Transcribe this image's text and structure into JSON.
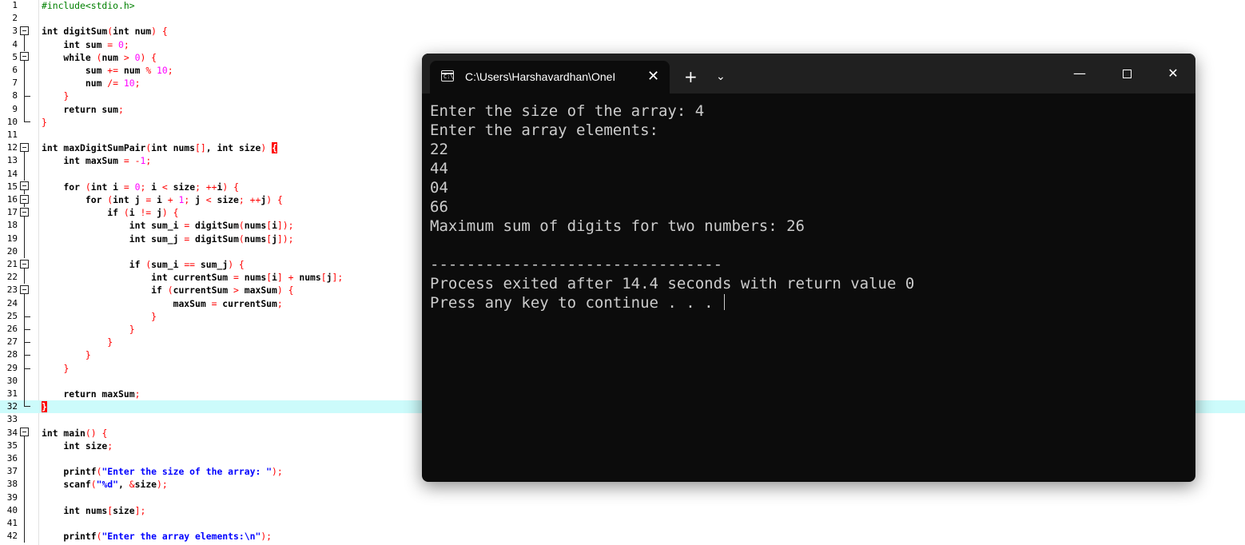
{
  "editor": {
    "lines": [
      {
        "n": "1",
        "fold": "",
        "html": "<span class=\"pp\">#include&lt;stdio.h&gt;</span>"
      },
      {
        "n": "2",
        "fold": "",
        "html": ""
      },
      {
        "n": "3",
        "fold": "open",
        "html": "int digitSum<span class=\"op\">(</span>int num<span class=\"op\">)</span> <span class=\"op\">{</span>"
      },
      {
        "n": "4",
        "fold": "line",
        "html": "    int sum <span class=\"op\">=</span> <span class=\"num\">0</span><span class=\"op\">;</span>"
      },
      {
        "n": "5",
        "fold": "open",
        "html": "    while <span class=\"op\">(</span>num <span class=\"op\">&gt;</span> <span class=\"num\">0</span><span class=\"op\">)</span> <span class=\"op\">{</span>"
      },
      {
        "n": "6",
        "fold": "line",
        "html": "        sum <span class=\"op\">+=</span> num <span class=\"op\">%</span> <span class=\"num\">10</span><span class=\"op\">;</span>"
      },
      {
        "n": "7",
        "fold": "line",
        "html": "        num <span class=\"op\">/=</span> <span class=\"num\">10</span><span class=\"op\">;</span>"
      },
      {
        "n": "8",
        "fold": "mid",
        "html": "    <span class=\"op\">}</span>"
      },
      {
        "n": "9",
        "fold": "line",
        "html": "    return sum<span class=\"op\">;</span>"
      },
      {
        "n": "10",
        "fold": "end",
        "html": "<span class=\"op\">}</span>"
      },
      {
        "n": "11",
        "fold": "",
        "html": ""
      },
      {
        "n": "12",
        "fold": "open",
        "html": "int maxDigitSumPair<span class=\"op\">(</span>int nums<span class=\"op\">[]</span>, int size<span class=\"op\">)</span> <span class=\"brk\">{</span>"
      },
      {
        "n": "13",
        "fold": "line",
        "html": "    int maxSum <span class=\"op\">=</span> <span class=\"op\">-</span><span class=\"num\">1</span><span class=\"op\">;</span>"
      },
      {
        "n": "14",
        "fold": "line",
        "html": ""
      },
      {
        "n": "15",
        "fold": "open",
        "html": "    for <span class=\"op\">(</span>int i <span class=\"op\">=</span> <span class=\"num\">0</span><span class=\"op\">;</span> i <span class=\"op\">&lt;</span> size<span class=\"op\">;</span> <span class=\"op\">++</span>i<span class=\"op\">)</span> <span class=\"op\">{</span>"
      },
      {
        "n": "16",
        "fold": "open",
        "html": "        for <span class=\"op\">(</span>int j <span class=\"op\">=</span> i <span class=\"op\">+</span> <span class=\"num\">1</span><span class=\"op\">;</span> j <span class=\"op\">&lt;</span> size<span class=\"op\">;</span> <span class=\"op\">++</span>j<span class=\"op\">)</span> <span class=\"op\">{</span>"
      },
      {
        "n": "17",
        "fold": "open",
        "html": "            if <span class=\"op\">(</span>i <span class=\"op\">!=</span> j<span class=\"op\">)</span> <span class=\"op\">{</span>"
      },
      {
        "n": "18",
        "fold": "line",
        "html": "                int sum_i <span class=\"op\">=</span> digitSum<span class=\"op\">(</span>nums<span class=\"op\">[</span>i<span class=\"op\">]);</span>"
      },
      {
        "n": "19",
        "fold": "line",
        "html": "                int sum_j <span class=\"op\">=</span> digitSum<span class=\"op\">(</span>nums<span class=\"op\">[</span>j<span class=\"op\">]);</span>"
      },
      {
        "n": "20",
        "fold": "line",
        "html": ""
      },
      {
        "n": "21",
        "fold": "open",
        "html": "                if <span class=\"op\">(</span>sum_i <span class=\"op\">==</span> sum_j<span class=\"op\">)</span> <span class=\"op\">{</span>"
      },
      {
        "n": "22",
        "fold": "line",
        "html": "                    int currentSum <span class=\"op\">=</span> nums<span class=\"op\">[</span>i<span class=\"op\">]</span> <span class=\"op\">+</span> nums<span class=\"op\">[</span>j<span class=\"op\">];</span>"
      },
      {
        "n": "23",
        "fold": "open",
        "html": "                    if <span class=\"op\">(</span>currentSum <span class=\"op\">&gt;</span> maxSum<span class=\"op\">)</span> <span class=\"op\">{</span>"
      },
      {
        "n": "24",
        "fold": "line",
        "html": "                        maxSum <span class=\"op\">=</span> currentSum<span class=\"op\">;</span>"
      },
      {
        "n": "25",
        "fold": "mid",
        "html": "                    <span class=\"op\">}</span>"
      },
      {
        "n": "26",
        "fold": "mid",
        "html": "                <span class=\"op\">}</span>"
      },
      {
        "n": "27",
        "fold": "mid",
        "html": "            <span class=\"op\">}</span>"
      },
      {
        "n": "28",
        "fold": "mid",
        "html": "        <span class=\"op\">}</span>"
      },
      {
        "n": "29",
        "fold": "mid",
        "html": "    <span class=\"op\">}</span>"
      },
      {
        "n": "30",
        "fold": "line",
        "html": ""
      },
      {
        "n": "31",
        "fold": "line",
        "html": "    return maxSum<span class=\"op\">;</span>"
      },
      {
        "n": "32",
        "fold": "end",
        "html": "<span class=\"brk\">}</span>",
        "highlight": true
      },
      {
        "n": "33",
        "fold": "",
        "html": ""
      },
      {
        "n": "34",
        "fold": "open",
        "html": "int main<span class=\"op\">()</span> <span class=\"op\">{</span>"
      },
      {
        "n": "35",
        "fold": "line",
        "html": "    int size<span class=\"op\">;</span>"
      },
      {
        "n": "36",
        "fold": "line",
        "html": ""
      },
      {
        "n": "37",
        "fold": "line",
        "html": "    printf<span class=\"op\">(</span><span class=\"str\">\"Enter the size of the array: \"</span><span class=\"op\">);</span>"
      },
      {
        "n": "38",
        "fold": "line",
        "html": "    scanf<span class=\"op\">(</span><span class=\"str\">\"%d\"</span>, <span class=\"op\">&amp;</span>size<span class=\"op\">);</span>"
      },
      {
        "n": "39",
        "fold": "line",
        "html": ""
      },
      {
        "n": "40",
        "fold": "line",
        "html": "    int nums<span class=\"op\">[</span>size<span class=\"op\">];</span>"
      },
      {
        "n": "41",
        "fold": "line",
        "html": ""
      },
      {
        "n": "42",
        "fold": "line",
        "html": "    printf<span class=\"op\">(</span><span class=\"str\">\"Enter the array elements:\\n\"</span><span class=\"op\">);</span>"
      }
    ]
  },
  "console": {
    "tab_title": "C:\\Users\\Harshavardhan\\OneI",
    "tab_icon_glyph": "C:\\",
    "close_tab_glyph": "✕",
    "new_tab_glyph": "+",
    "dropdown_glyph": "⌄",
    "minimize_glyph": "—",
    "close_window_glyph": "✕",
    "output_lines": [
      "Enter the size of the array: 4",
      "Enter the array elements:",
      "22",
      "44",
      "04",
      "66",
      "Maximum sum of digits for two numbers: 26",
      "",
      "--------------------------------",
      "Process exited after 14.4 seconds with return value 0",
      "Press any key to continue . . . "
    ]
  }
}
